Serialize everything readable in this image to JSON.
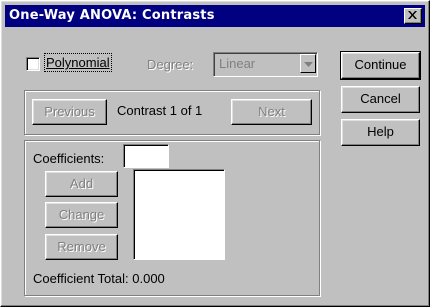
{
  "window": {
    "title": "One-Way ANOVA: Contrasts",
    "close_glyph": "close-icon"
  },
  "polynomial": {
    "label": "Polynomial",
    "checked": false
  },
  "degree": {
    "label": "Degree:",
    "value": "Linear",
    "enabled": false
  },
  "navigation": {
    "previous_label": "Previous",
    "contrast_text": "Contrast 1 of 1",
    "next_label": "Next"
  },
  "coefficients": {
    "label": "Coefficients:",
    "value": "",
    "add_label": "Add",
    "change_label": "Change",
    "remove_label": "Remove",
    "list_items": [],
    "total_text": "Coefficient Total: 0.000"
  },
  "buttons": {
    "continue_label": "Continue",
    "cancel_label": "Cancel",
    "help_label": "Help"
  }
}
